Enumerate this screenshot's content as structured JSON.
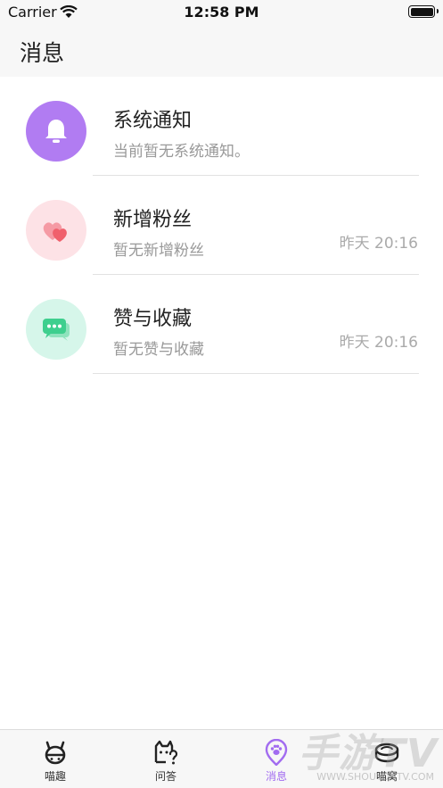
{
  "status_bar": {
    "carrier": "Carrier",
    "time": "12:58 PM"
  },
  "header": {
    "title": "消息"
  },
  "messages": [
    {
      "title": "系统通知",
      "subtitle": "当前暂无系统通知。",
      "time": "",
      "icon": "bell-icon",
      "avatar_color": "#b17cf2",
      "icon_color": "#ffffff"
    },
    {
      "title": "新增粉丝",
      "subtitle": "暂无新增粉丝",
      "time": "昨天 20:16",
      "icon": "hearts-icon",
      "avatar_color": "#fde2e6",
      "icon_color": "#f0606c"
    },
    {
      "title": "赞与收藏",
      "subtitle": "暂无赞与收藏",
      "time": "昨天 20:16",
      "icon": "chat-bubbles-icon",
      "avatar_color": "#d6f6ea",
      "icon_color": "#3ecf8e"
    }
  ],
  "tabs": [
    {
      "label": "喵趣",
      "icon": "cat-face-icon",
      "active": false
    },
    {
      "label": "问答",
      "icon": "cat-question-icon",
      "active": false
    },
    {
      "label": "消息",
      "icon": "paw-pin-icon",
      "active": true
    },
    {
      "label": "喵窝",
      "icon": "cat-bed-icon",
      "active": false
    }
  ],
  "accent_color": "#a26cf0",
  "watermark": {
    "big": "手游TV",
    "small": "WWW.SHOUYOUTV.COM"
  }
}
